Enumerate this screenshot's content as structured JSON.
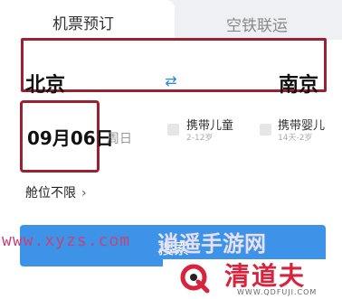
{
  "tabs": {
    "flight": "机票预订",
    "air_rail": "空铁联运"
  },
  "route": {
    "from": "北京",
    "to": "南京"
  },
  "date": {
    "value": "09月06日",
    "weekday": "周日"
  },
  "passengers": {
    "child_label": "携带儿童",
    "child_age": "2-12岁",
    "infant_label": "携带婴儿",
    "infant_age": "14天-2岁"
  },
  "cabin": {
    "label": "舱位不限"
  },
  "search": {
    "label": "搜索"
  },
  "watermark": {
    "site": "www.xyzs.com",
    "site_name": "逍遥手游网",
    "brand": "清道夫",
    "brand_url": "WWW.QDFUJI.COM"
  },
  "colors": {
    "accent": "#3d93e8",
    "highlight_box": "#9b2030",
    "brand": "#d8233d"
  }
}
